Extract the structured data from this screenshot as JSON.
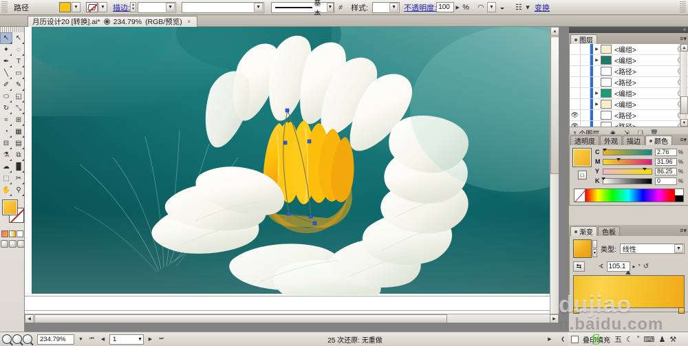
{
  "app": {
    "name": "Adobe Illustrator",
    "accent": "#2020b0"
  },
  "control_bar": {
    "context_label": "路径",
    "fill_swatch_color": "#f5c518",
    "stroke_label": "描边:",
    "stroke_weight_value": "",
    "stroke_profile_value": "",
    "brush_label": "基本",
    "style_label": "样式:",
    "style_value": "",
    "opacity_label": "不透明度:",
    "opacity_value": "100",
    "opacity_unit": "%",
    "transform_link": "变换",
    "icons": {
      "fill_dropdown": "chevron-down-icon",
      "stroke_none": "no-stroke-icon",
      "stroke_dropdown": "chevron-down-icon",
      "stroke_stepper": "stepper-icon",
      "brush_dropdown": "chevron-down-icon",
      "variable_width": "width-profile-icon",
      "style_dropdown": "chevron-down-icon",
      "opacity_stepper": "chevron-right-icon",
      "isolate_blend": "isolate-blend-icon",
      "knockout": "knockout-icon",
      "align": "align-icon",
      "grip": "drag-grip-icon",
      "overflow": "overflow-grip-icon"
    }
  },
  "tab": {
    "title": "月历设计20 [转换].ai*",
    "zoom": "234.79%",
    "mode": "(RGB/预览)",
    "proof_icon": "proof-view-icon",
    "close_icon": "×"
  },
  "toolbox": {
    "tools": [
      {
        "name": "selection-tool",
        "glyph": "↖",
        "selected": true
      },
      {
        "name": "direct-selection-tool",
        "glyph": "↖",
        "selected": false
      },
      {
        "name": "magic-wand-tool",
        "glyph": "✦",
        "selected": false
      },
      {
        "name": "lasso-tool",
        "glyph": "◌",
        "selected": false
      },
      {
        "name": "pen-tool",
        "glyph": "✒",
        "selected": false
      },
      {
        "name": "type-tool",
        "glyph": "T",
        "selected": false
      },
      {
        "name": "line-segment-tool",
        "glyph": "╲",
        "selected": false
      },
      {
        "name": "rectangle-tool",
        "glyph": "▭",
        "selected": false
      },
      {
        "name": "paintbrush-tool",
        "glyph": "✐",
        "selected": false
      },
      {
        "name": "pencil-tool",
        "glyph": "✎",
        "selected": false
      },
      {
        "name": "blob-brush-tool",
        "glyph": "⬭",
        "selected": false
      },
      {
        "name": "eraser-tool",
        "glyph": "◱",
        "selected": false
      },
      {
        "name": "rotate-tool",
        "glyph": "↻",
        "selected": false
      },
      {
        "name": "scale-tool",
        "glyph": "⤡",
        "selected": false
      },
      {
        "name": "width-tool",
        "glyph": "≈",
        "selected": false
      },
      {
        "name": "free-transform-tool",
        "glyph": "⊞",
        "selected": false
      },
      {
        "name": "shape-builder-tool",
        "glyph": "◔",
        "selected": false
      },
      {
        "name": "perspective-grid-tool",
        "glyph": "▦",
        "selected": false
      },
      {
        "name": "mesh-tool",
        "glyph": "⊟",
        "selected": false
      },
      {
        "name": "gradient-tool",
        "glyph": "▤",
        "selected": false
      },
      {
        "name": "eyedropper-tool",
        "glyph": "⚗",
        "selected": false
      },
      {
        "name": "blend-tool",
        "glyph": "⧉",
        "selected": false
      },
      {
        "name": "symbol-sprayer-tool",
        "glyph": "☁",
        "selected": false
      },
      {
        "name": "column-graph-tool",
        "glyph": "█",
        "selected": false
      },
      {
        "name": "artboard-tool",
        "glyph": "⬚",
        "selected": false
      },
      {
        "name": "slice-tool",
        "glyph": "✂",
        "selected": false
      },
      {
        "name": "hand-tool",
        "glyph": "✋",
        "selected": false
      },
      {
        "name": "zoom-tool",
        "glyph": "⚲",
        "selected": false
      }
    ],
    "fill_color": "#f2b41c",
    "stroke_color": "none",
    "swatch_modes": [
      "color-swatch",
      "gradient-swatch",
      "none-swatch"
    ],
    "screen_modes": [
      "normal-screen-mode",
      "fullscreen-menubar-mode",
      "fullscreen-mode"
    ]
  },
  "artwork": {
    "description": "白色睡莲 / white water lily on teal background",
    "background_color": "#0c6264",
    "background_light": "#1e8a8a",
    "petal_color": "#fdfcf7",
    "petal_shadow": "#e6e7dd",
    "stamen_color": "#ffc20a",
    "stamen_dark": "#f0960f",
    "selection_color": "#2b5fd9"
  },
  "layers_panel": {
    "tabs": [
      {
        "label": "图层",
        "active": true
      }
    ],
    "menu_icon": "panel-menu-icon",
    "rows": [
      {
        "visible": false,
        "locked": false,
        "expandable": true,
        "name": "<编组>",
        "thumb": "#f3efcf"
      },
      {
        "visible": false,
        "locked": false,
        "expandable": true,
        "name": "<编组>",
        "thumb": "#1f7a68"
      },
      {
        "visible": false,
        "locked": false,
        "expandable": false,
        "name": "<路径>",
        "thumb": "#ffffff"
      },
      {
        "visible": false,
        "locked": false,
        "expandable": false,
        "name": "<路径>",
        "thumb": "#ffffff"
      },
      {
        "visible": false,
        "locked": false,
        "expandable": true,
        "name": "<编组>",
        "thumb": "#1f9a78"
      },
      {
        "visible": false,
        "locked": false,
        "expandable": true,
        "name": "<编组>",
        "thumb": "#f7f0c6"
      },
      {
        "visible": true,
        "locked": false,
        "expandable": false,
        "name": "<路径>",
        "thumb": "#ffffff"
      },
      {
        "visible": true,
        "locked": false,
        "expandable": false,
        "name": "<路径>",
        "thumb": "#ffffff"
      }
    ],
    "footer_count": "1 个图层",
    "footer_icons": [
      "make-clipping-mask-icon",
      "create-sublayer-icon",
      "create-new-layer-icon",
      "delete-selection-icon"
    ]
  },
  "color_panel": {
    "tabs": [
      {
        "label": "透明度",
        "active": false
      },
      {
        "label": "外观",
        "active": false
      },
      {
        "label": "描边",
        "active": false
      },
      {
        "label": "颜色",
        "active": true
      }
    ],
    "menu_icon": "panel-menu-icon",
    "mode": "CMYK",
    "fill_preview": "#f2b41c",
    "channels": [
      {
        "label": "C",
        "value": "2.76",
        "unit": "%",
        "pct": 2.76,
        "from": "#f2b41c",
        "to": "#0f8a8a"
      },
      {
        "label": "M",
        "value": "31.96",
        "unit": "%",
        "pct": 31.96,
        "from": "#f2e01c",
        "to": "#e0187f"
      },
      {
        "label": "Y",
        "value": "86.25",
        "unit": "%",
        "pct": 86.25,
        "from": "#f2b4cf",
        "to": "#f2e000"
      },
      {
        "label": "K",
        "value": "0",
        "unit": "%",
        "pct": 0,
        "from": "#ffffff",
        "to": "#000000"
      }
    ]
  },
  "gradient_panel": {
    "tabs": [
      {
        "label": "渐变",
        "active": true
      },
      {
        "label": "色板",
        "active": false
      }
    ],
    "menu_icon": "panel-menu-icon",
    "type_label": "类型:",
    "type_value": "线性",
    "angle_value": "105.1",
    "angle_unit": "°",
    "stops": [
      {
        "position": 0,
        "color": "#f3c22b"
      },
      {
        "position": 100,
        "color": "#f0aa19"
      }
    ],
    "midpoint": 50,
    "icons": {
      "reverse_gradient": "reverse-gradient-icon",
      "angle_stepper": "chevron-right-icon",
      "aspect_ratio": "aspect-ratio-icon",
      "opacity_field": "opacity-field",
      "location_field": "location-field"
    }
  },
  "status_bar": {
    "zoom_value": "234.79%",
    "page_value": "1",
    "status_text": "25 次还原: 无重做",
    "zoom_dropdown_icon": "chevron-down-icon",
    "first_page_icon": "⏮",
    "prev_page_icon": "◀",
    "next_page_icon": "▶",
    "last_page_icon": "⏭",
    "status_menu_icon": "▶",
    "resize_grip_icon": "resize-grip-icon"
  },
  "taskbar": {
    "overprint_label": "叠印填充",
    "overprint_checked": false,
    "tray_items": [
      {
        "name": "tray-ime-icon",
        "glyph": "五"
      },
      {
        "name": "tray-moon-icon",
        "glyph": "☾"
      },
      {
        "name": "tray-quote-icon",
        "glyph": "”"
      },
      {
        "name": "tray-keyboard-icon",
        "glyph": "⌨"
      },
      {
        "name": "tray-user-icon",
        "glyph": "♟"
      },
      {
        "name": "tray-tools-icon",
        "glyph": "⚒"
      }
    ]
  },
  "watermarks": {
    "logo": "dujiao",
    "url": "n.baidu.com",
    "badge": "S"
  }
}
